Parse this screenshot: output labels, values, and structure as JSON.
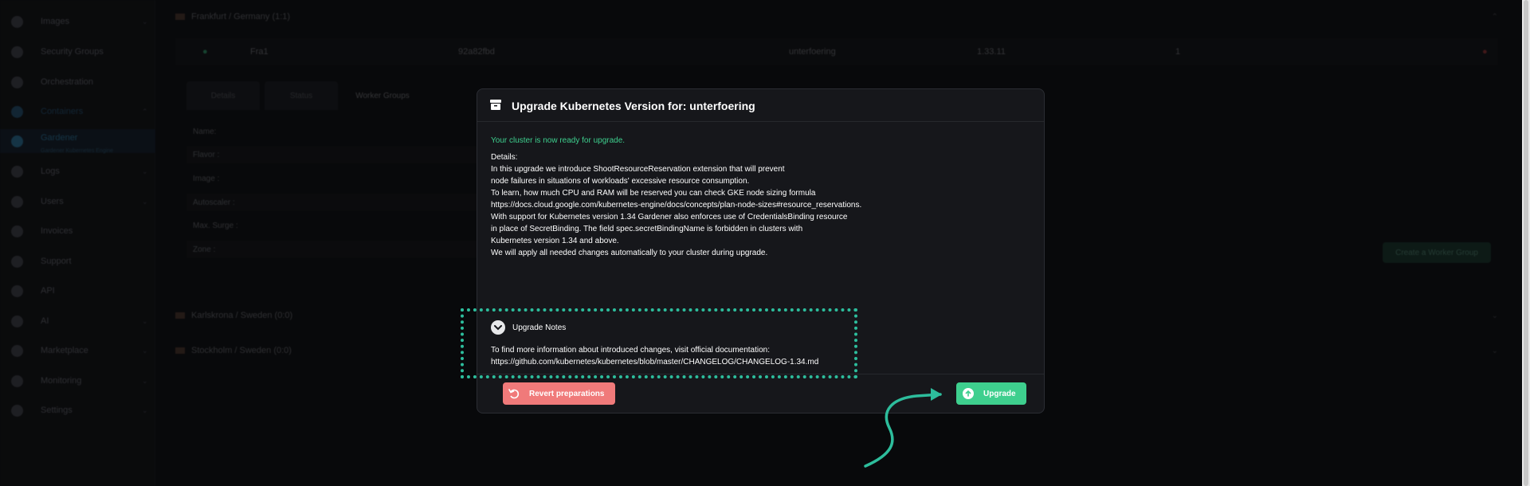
{
  "sidebar": {
    "items": [
      {
        "label": "Images",
        "has_chevron": true
      },
      {
        "label": "Security Groups",
        "has_chevron": false
      },
      {
        "label": "Orchestration",
        "has_chevron": false
      },
      {
        "label": "Containers",
        "has_chevron": true
      },
      {
        "label": "Gardener",
        "has_chevron": false
      },
      {
        "label": "Logs",
        "has_chevron": true
      },
      {
        "label": "Users",
        "has_chevron": true
      },
      {
        "label": "Invoices",
        "has_chevron": false
      },
      {
        "label": "Support",
        "has_chevron": false
      },
      {
        "label": "API",
        "has_chevron": false
      },
      {
        "label": "AI",
        "has_chevron": true
      },
      {
        "label": "Marketplace",
        "has_chevron": true
      },
      {
        "label": "Monitoring",
        "has_chevron": true
      },
      {
        "label": "Settings",
        "has_chevron": true
      }
    ],
    "active_sub_label": "Gardener Kubernetes Engine"
  },
  "main": {
    "regions": [
      {
        "label": "Frankfurt / Germany (1:1)"
      },
      {
        "label": "Karlskrona / Sweden (0:0)"
      },
      {
        "label": "Stockholm / Sweden (0:0)"
      }
    ],
    "cluster_row": {
      "name": "Fra1",
      "id": "92a82fbd",
      "project": "unterfoering",
      "version": "1.33.11",
      "count": "1"
    },
    "tabs": [
      "Details",
      "Status",
      "Worker Groups",
      "",
      "",
      ""
    ],
    "form_rows": [
      "Name:",
      "Flavor :",
      "Image :",
      "Autoscaler :",
      "Max. Surge :",
      "Zone :"
    ],
    "create_worker_group_label": "Create a Worker Group"
  },
  "modal": {
    "title": "Upgrade Kubernetes Version for: unterfoering",
    "ready_text": "Your cluster is now ready for upgrade.",
    "details_lines": [
      "Details:",
      "In this upgrade we introduce ShootResourceReservation extension that will prevent",
      "node failures in situations of workloads' excessive resource consumption.",
      "To learn, how much CPU and RAM will be reserved you can check GKE node sizing formula",
      "https://docs.cloud.google.com/kubernetes-engine/docs/concepts/plan-node-sizes#resource_reservations.",
      "With support for Kubernetes version 1.34 Gardener also enforces use of CredentialsBinding resource",
      "in place of SecretBinding. The field spec.secretBindingName is forbidden in clusters with",
      "Kubernetes version 1.34 and above.",
      "We will apply all needed changes automatically to your cluster during upgrade."
    ],
    "notes": {
      "title": "Upgrade Notes",
      "line1": "To find more information about introduced changes, visit official documentation:",
      "line2": "https://github.com/kubernetes/kubernetes/blob/master/CHANGELOG/CHANGELOG-1.34.md"
    },
    "revert_label": "Revert preparations",
    "upgrade_label": "Upgrade"
  },
  "colors": {
    "accent_green": "#3ecf8e",
    "danger_red": "#f07a7a",
    "highlight_teal": "#2dbd9c",
    "modal_bg": "#16171b"
  }
}
